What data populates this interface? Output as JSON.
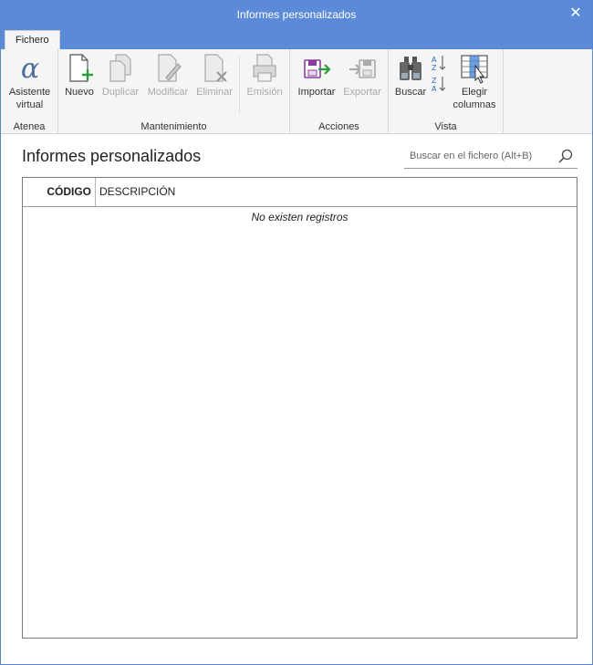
{
  "window": {
    "title": "Informes personalizados",
    "close_glyph": "✕"
  },
  "tabs": [
    {
      "label": "Fichero"
    }
  ],
  "ribbon": {
    "groups": [
      {
        "label": "Atenea",
        "buttons": [
          {
            "label": "Asistente virtual",
            "icon": "alpha-icon",
            "enabled": true
          }
        ]
      },
      {
        "label": "Mantenimiento",
        "buttons": [
          {
            "label": "Nuevo",
            "icon": "new-document-icon",
            "enabled": true
          },
          {
            "label": "Duplicar",
            "icon": "duplicate-icon",
            "enabled": false
          },
          {
            "label": "Modificar",
            "icon": "edit-document-icon",
            "enabled": false
          },
          {
            "label": "Eliminar",
            "icon": "delete-document-icon",
            "enabled": false
          },
          {
            "label": "Emisión",
            "icon": "print-icon",
            "enabled": false
          }
        ]
      },
      {
        "label": "Acciones",
        "buttons": [
          {
            "label": "Importar",
            "icon": "import-icon",
            "enabled": true
          },
          {
            "label": "Exportar",
            "icon": "export-icon",
            "enabled": false
          }
        ]
      },
      {
        "label": "Vista",
        "buttons": [
          {
            "label": "Buscar",
            "icon": "binoculars-icon",
            "enabled": true
          },
          {
            "label": "",
            "icon": "sort-icon",
            "enabled": true
          },
          {
            "label": "Elegir columnas",
            "icon": "choose-columns-icon",
            "enabled": true
          }
        ]
      }
    ]
  },
  "content": {
    "title": "Informes personalizados",
    "search_placeholder": "Buscar en el fichero (Alt+B)"
  },
  "grid": {
    "columns": [
      "CÓDIGO",
      "DESCRIPCIÓN"
    ],
    "empty_message": "No existen registros"
  },
  "colors": {
    "titlebar": "#5b8bd8",
    "ribbon_bg": "#f5f5f5",
    "accent_green": "#2e9e3e",
    "accent_purple": "#8a3c9e"
  }
}
